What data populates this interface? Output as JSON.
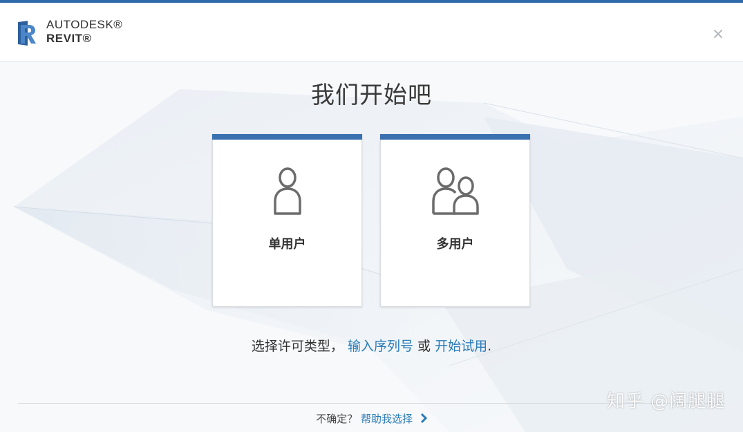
{
  "header": {
    "brand_line1": "AUTODESK®",
    "brand_line2": "REVIT®",
    "close_symbol": "×"
  },
  "main": {
    "title": "我们开始吧",
    "cards": [
      {
        "label": "单用户",
        "icon": "single-user-icon"
      },
      {
        "label": "多用户",
        "icon": "multi-user-icon"
      }
    ],
    "license_prompt": "选择许可类型，",
    "enter_serial_link": "输入序列号",
    "or_text": "或",
    "start_trial_link": "开始试用",
    "period": "."
  },
  "footer": {
    "unsure_text": "不确定？",
    "help_link": "帮助我选择"
  },
  "watermark": "知乎 @阔腿腿",
  "colors": {
    "accent_bar": "#2f6aa8",
    "card_top": "#3a6fb0",
    "link": "#2a7bb8",
    "logo_blue": "#3a75b5"
  }
}
